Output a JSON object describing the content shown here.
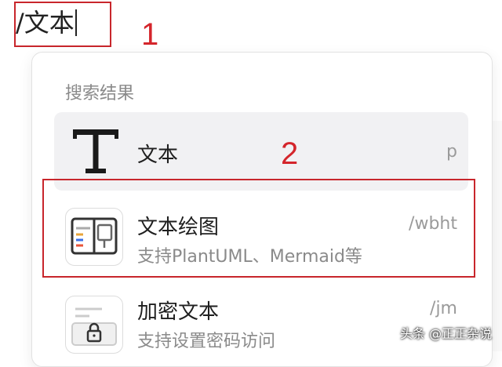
{
  "editor": {
    "input_text": "/文本"
  },
  "annotations": {
    "label_1": "1",
    "label_2": "2"
  },
  "menu": {
    "section_title": "搜索结果",
    "items": [
      {
        "title": "文本",
        "description": "",
        "shortcut": "p",
        "icon": "text-T-icon",
        "selected": true
      },
      {
        "title": "文本绘图",
        "description": "支持PlantUML、Mermaid等",
        "shortcut": "/wbht",
        "icon": "diagram-icon",
        "selected": false
      },
      {
        "title": "加密文本",
        "description": "支持设置密码访问",
        "shortcut": "/jm",
        "icon": "lock-icon",
        "selected": false
      }
    ]
  },
  "watermark": "头条 @正正杂说",
  "colors": {
    "annotation_red": "#d4252b",
    "selected_bg": "#f1f1f3",
    "muted_text": "#8a8a8a"
  }
}
